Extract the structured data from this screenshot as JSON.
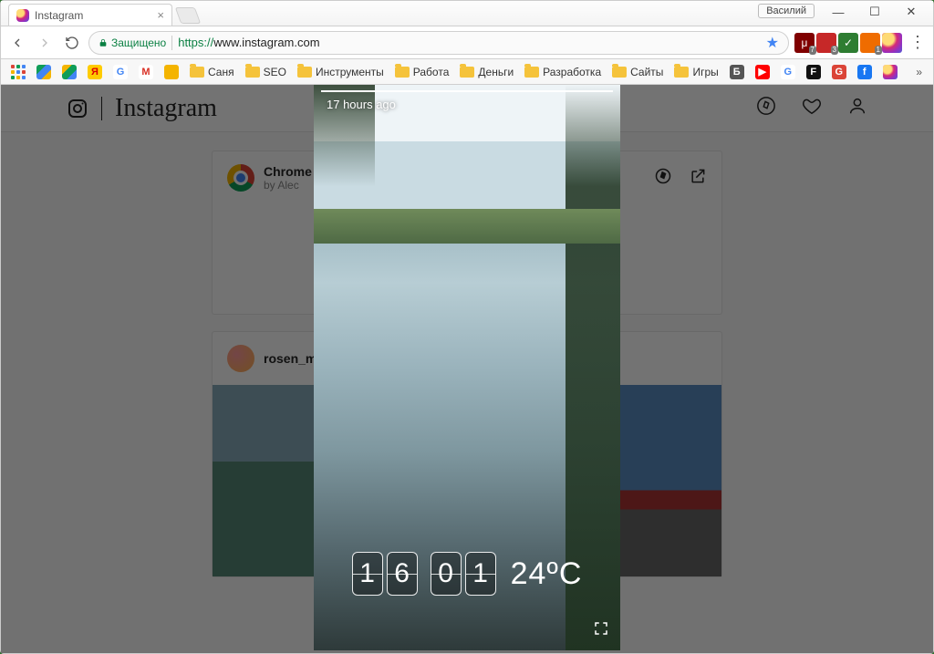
{
  "window": {
    "user_label": "Василий"
  },
  "tab": {
    "title": "Instagram"
  },
  "omnibox": {
    "secure_label": "Защищено",
    "url_proto": "https://",
    "url_host": "www.instagram.com",
    "url_path": ""
  },
  "extensions": [
    {
      "name": "ublock",
      "bg": "#800000",
      "label": "μ",
      "badge": "7"
    },
    {
      "name": "ext-red",
      "bg": "#c62828",
      "label": "",
      "badge": "3"
    },
    {
      "name": "adguard",
      "bg": "#2e7d32",
      "label": "✓",
      "badge": ""
    },
    {
      "name": "ext-orange",
      "bg": "#ef6c00",
      "label": "",
      "badge": "1"
    },
    {
      "name": "ig-ext",
      "bg": "radial",
      "label": "",
      "badge": ""
    }
  ],
  "bookmarks": {
    "items": [
      {
        "type": "apps"
      },
      {
        "type": "icon",
        "name": "gdrive",
        "bg": "linear-gradient(135deg,#0f9d58 33%,#4285f4 33% 66%,#f4b400 66%)"
      },
      {
        "type": "icon",
        "name": "gdrive2",
        "bg": "linear-gradient(135deg,#f4b400 33%,#0f9d58 33% 66%,#4285f4 66%)"
      },
      {
        "type": "icon",
        "name": "yandex",
        "bg": "#ffcc00",
        "text": "Я",
        "color": "#d00"
      },
      {
        "type": "icon",
        "name": "google",
        "bg": "#fff",
        "text": "G",
        "color": "#4285f4"
      },
      {
        "type": "icon",
        "name": "gmail",
        "bg": "#fff",
        "text": "M",
        "color": "#d93025"
      },
      {
        "type": "icon",
        "name": "note",
        "bg": "#f4b400"
      },
      {
        "type": "folder",
        "label": "Саня"
      },
      {
        "type": "folder",
        "label": "SEO"
      },
      {
        "type": "folder",
        "label": "Инструменты"
      },
      {
        "type": "folder",
        "label": "Работа"
      },
      {
        "type": "folder",
        "label": "Деньги"
      },
      {
        "type": "folder",
        "label": "Разработка"
      },
      {
        "type": "folder",
        "label": "Сайты"
      },
      {
        "type": "folder",
        "label": "Игры"
      },
      {
        "type": "icon",
        "name": "b",
        "bg": "#555",
        "text": "Б",
        "color": "#fff"
      },
      {
        "type": "icon",
        "name": "youtube",
        "bg": "#ff0000",
        "text": "▶",
        "color": "#fff"
      },
      {
        "type": "icon",
        "name": "google2",
        "bg": "#fff",
        "text": "G",
        "color": "#4285f4"
      },
      {
        "type": "icon",
        "name": "f",
        "bg": "#111",
        "text": "F",
        "color": "#fff"
      },
      {
        "type": "icon",
        "name": "gplus",
        "bg": "#db4437",
        "text": "G",
        "color": "#fff"
      },
      {
        "type": "icon",
        "name": "fb",
        "bg": "#1877f2",
        "text": "f",
        "color": "#fff"
      },
      {
        "type": "icon",
        "name": "ig",
        "bg": "radial"
      }
    ]
  },
  "ig": {
    "logo_word": "Instagram",
    "feed": [
      {
        "title": "Chrome",
        "sub": "by Alec"
      },
      {
        "title": "rosen_ma",
        "sub": ""
      }
    ]
  },
  "story": {
    "time_label": "17 hours ago",
    "clock_digits": [
      "1",
      "6",
      "0",
      "1"
    ],
    "temperature": "24ºC"
  }
}
